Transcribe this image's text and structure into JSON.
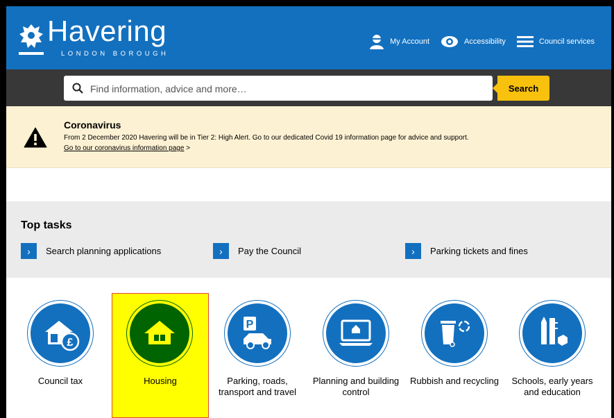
{
  "header": {
    "logo_name": "Havering",
    "logo_sub": "LONDON BOROUGH",
    "links": [
      {
        "label": "My Account",
        "icon": "user-icon"
      },
      {
        "label": "Accessibility",
        "icon": "eye-icon"
      },
      {
        "label": "Council services",
        "icon": "menu-icon"
      }
    ]
  },
  "search": {
    "placeholder": "Find information, advice and more…",
    "button_label": "Search"
  },
  "alert": {
    "title": "Coronavirus",
    "text": "From 2 December 2020 Havering will be in Tier 2: High Alert. Go to our dedicated Covid 19 information page for advice and support.",
    "link_label": "Go to our coronavirus information page",
    "link_suffix": " >"
  },
  "top_tasks": {
    "title": "Top tasks",
    "items": [
      {
        "label": "Search planning applications"
      },
      {
        "label": "Pay the Council"
      },
      {
        "label": "Parking tickets and fines"
      }
    ]
  },
  "services": [
    {
      "label": "Council tax",
      "icon": "council-tax-icon",
      "selected": false
    },
    {
      "label": "Housing",
      "icon": "housing-icon",
      "selected": true
    },
    {
      "label": "Parking, roads, transport and travel",
      "icon": "parking-icon",
      "selected": false
    },
    {
      "label": "Planning and building control",
      "icon": "planning-icon",
      "selected": false
    },
    {
      "label": "Rubbish and recycling",
      "icon": "recycling-icon",
      "selected": false
    },
    {
      "label": "Schools, early years and education",
      "icon": "schools-icon",
      "selected": false
    }
  ],
  "colors": {
    "brand_blue": "#1370bf",
    "search_yellow": "#f8c10d",
    "alert_bg": "#fdf1d3",
    "highlight_yellow": "#ffff00",
    "highlight_green": "#006400"
  }
}
